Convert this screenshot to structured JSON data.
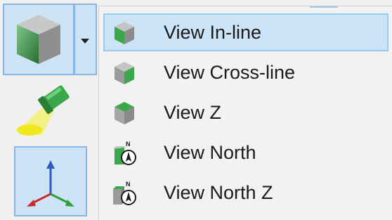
{
  "toolbar": {
    "view_button_icon": "cube-view-icon",
    "dropdown_icon": "dropdown-arrow-icon",
    "light_icon": "spotlight-icon",
    "axes_icon": "xyz-axes-icon"
  },
  "menu": {
    "items": [
      {
        "label": "View In-line",
        "icon": "cube-inline-icon",
        "selected": true
      },
      {
        "label": "View Cross-line",
        "icon": "cube-crossline-icon",
        "selected": false
      },
      {
        "label": "View Z",
        "icon": "cube-z-icon",
        "selected": false
      },
      {
        "label": "View North",
        "icon": "north-compass-icon",
        "selected": false
      },
      {
        "label": "View North Z",
        "icon": "north-z-compass-icon",
        "selected": false
      }
    ]
  },
  "colors": {
    "selected_bg": "#cce4f7",
    "selected_border": "#99c9ef",
    "cube_green": "#2e9e3a",
    "cube_gray": "#9a9a9a"
  }
}
